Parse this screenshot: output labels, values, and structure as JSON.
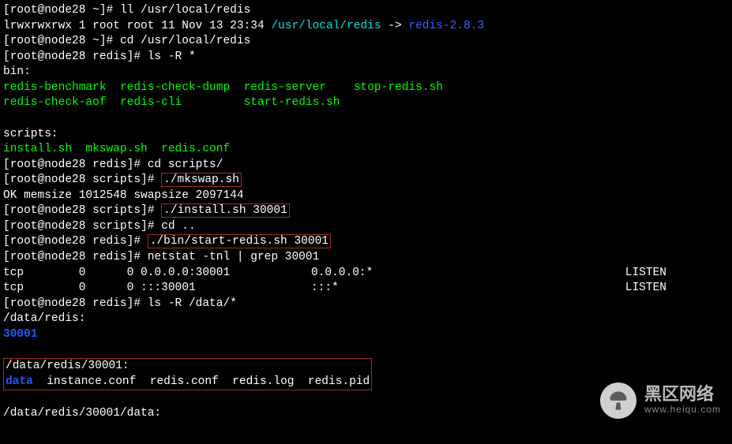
{
  "prompts": {
    "home": "[root@node28 ~]# ",
    "redis": "[root@node28 redis]# ",
    "scripts": "[root@node28 scripts]# "
  },
  "cmds": {
    "ll": "ll /usr/local/redis",
    "cd_redis": "cd /usr/local/redis",
    "ls_r": "ls -R *",
    "cd_scripts": "cd scripts/",
    "mkswap": "./mkswap.sh",
    "install": "./install.sh 30001",
    "cd_up": "cd ..",
    "start": "./bin/start-redis.sh 30001",
    "netstat": "netstat -tnl | grep 30001",
    "ls_data": "ls -R /data/*"
  },
  "out": {
    "ll_perm": "lrwxrwxrwx 1 root root 11 Nov 13 23:34 ",
    "ll_link": "/usr/local/redis",
    "ll_arrow": " -> ",
    "ll_target": "redis-2.8.3",
    "bin_header": "bin:",
    "bin_row1_c1": "redis-benchmark",
    "bin_row1_c2": "redis-check-dump",
    "bin_row1_c3": "redis-server",
    "bin_row1_c4": "stop-redis.sh",
    "bin_row2_c1": "redis-check-aof",
    "bin_row2_c2": "redis-cli",
    "bin_row2_c3": "start-redis.sh",
    "scripts_header": "scripts:",
    "scripts_c1": "install.sh",
    "scripts_c2": "mkswap.sh",
    "scripts_c3": "redis.conf",
    "mkswap_out": "OK memsize 1012548 swapsize 2097144",
    "tcp1_left": "tcp        0      0 0.0.0.0:30001",
    "tcp1_mid": "0.0.0.0:*",
    "tcp1_right": "LISTEN",
    "tcp2_left": "tcp        0      0 :::30001",
    "tcp2_mid": ":::*",
    "tcp2_right": "LISTEN",
    "data_redis": "/data/redis:",
    "port_dir": "30001",
    "data_redis_port": "/data/redis/30001:",
    "inst_c1": "data",
    "inst_c2": "instance.conf",
    "inst_c3": "redis.conf",
    "inst_c4": "redis.log",
    "inst_c5": "redis.pid",
    "data_final": "/data/redis/30001/data:"
  },
  "watermark": {
    "main": "黑区网络",
    "sub": "www.heiqu.com"
  }
}
